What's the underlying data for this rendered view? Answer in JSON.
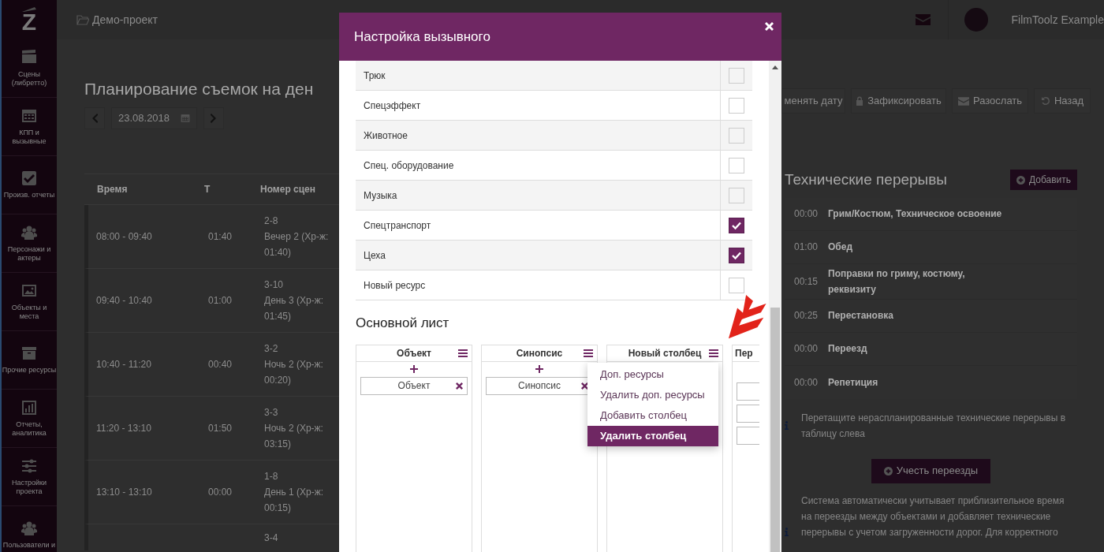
{
  "sidebar": {
    "logo": "Z",
    "items": [
      {
        "label": "Сцены (либретто)"
      },
      {
        "label": "КПП и вызывные"
      },
      {
        "label": "Произв. отчеты"
      },
      {
        "label": "Персонажи и актеры"
      },
      {
        "label": "Объекты и места"
      },
      {
        "label": "Прочие ресурсы"
      },
      {
        "label": "Отчеты, аналитика"
      },
      {
        "label": "Настройки проекта"
      },
      {
        "label": "Пользователи и"
      }
    ]
  },
  "topbar": {
    "project": "Демо-проект",
    "user": "FilmToolz Example"
  },
  "page": {
    "title": "Планирование съемок на ден",
    "date": "23.08.2018",
    "actions": [
      {
        "label": "менять дату"
      },
      {
        "label": "Зафиксировать"
      },
      {
        "label": "Разослать"
      },
      {
        "label": "Назад"
      }
    ]
  },
  "schedule": {
    "columns": [
      "Время",
      "Т",
      "Номер сцен"
    ],
    "rows": [
      {
        "time": "08:00 - 09:40",
        "duration": "01:40",
        "scene": "2-8",
        "description": "Вечер 2 (Хр-ж: 01:40)"
      },
      {
        "time": "09:40 - 10:40",
        "duration": "01:00",
        "scene": "3-10",
        "description": "День 3 (Хр-ж: 01:45)"
      },
      {
        "time": "10:40 - 11:20",
        "duration": "00:40",
        "scene": "3-2",
        "description": "Ночь 2 (Хр-ж: 00:20)"
      },
      {
        "time": "11:20 - 13:10",
        "duration": "01:50",
        "scene": "3-3",
        "description": "Ночь 2 (Хр-ж: 03:15)"
      },
      {
        "time": "13:10 - 13:10",
        "duration": "00:00",
        "scene": "1-8",
        "description": "День 1 (Хр-ж: 00:15)"
      },
      {
        "scene": "3-4"
      }
    ]
  },
  "breaks": {
    "title": "Технические перерывы",
    "add_button": "Добавить",
    "items": [
      {
        "time": "00:00",
        "label": "Грим/Костюм, Техническое освоение"
      },
      {
        "time": "01:00",
        "label": "Обед"
      },
      {
        "time": "00:15",
        "label": "Поправки по гриму, костюму, реквизиту"
      },
      {
        "time": "00:25",
        "label": "Перестановка"
      },
      {
        "time": "00:00",
        "label": "Переезд"
      },
      {
        "time": "00:00",
        "label": "Репетиция"
      }
    ],
    "hint": "Перетащите нераспланированные технические перерывы в таблицу слева",
    "button": "Учесть переезды",
    "note": "Система автоматически учитывает приблизительное время на переезды между объектами и добавляет технические перерывы с учетом загруженности дорог. Для корректного"
  },
  "modal": {
    "title": "Настройка вызывного",
    "resources": [
      {
        "label": "Трюк",
        "checked": false
      },
      {
        "label": "Спецэффект",
        "checked": false
      },
      {
        "label": "Животное",
        "checked": false
      },
      {
        "label": "Спец. оборудование",
        "checked": false
      },
      {
        "label": "Музыка",
        "checked": false
      },
      {
        "label": "Спецтранспорт",
        "checked": true
      },
      {
        "label": "Цеха",
        "checked": true
      },
      {
        "label": "Новый ресурс",
        "checked": false
      }
    ],
    "section_title": "Основной лист",
    "columns": [
      {
        "title": "Объект",
        "fields": [
          {
            "kind": "chip",
            "text": "Объект"
          }
        ]
      },
      {
        "title": "Синопсис",
        "fields": [
          {
            "kind": "chip",
            "text": "Синопсис"
          }
        ]
      },
      {
        "title": "Новый столбец"
      },
      {
        "title": "Пер",
        "fields": [
          {
            "kind": "blank"
          },
          {
            "kind": "blank"
          },
          {
            "kind": "blank"
          }
        ]
      }
    ],
    "menu": {
      "items": [
        {
          "label": "Доп. ресурсы",
          "selected": false
        },
        {
          "label": "Удалить доп. ресурсы",
          "selected": false
        },
        {
          "label": "Добавить столбец",
          "selected": false
        },
        {
          "label": "Удалить столбец",
          "selected": true
        }
      ]
    }
  }
}
